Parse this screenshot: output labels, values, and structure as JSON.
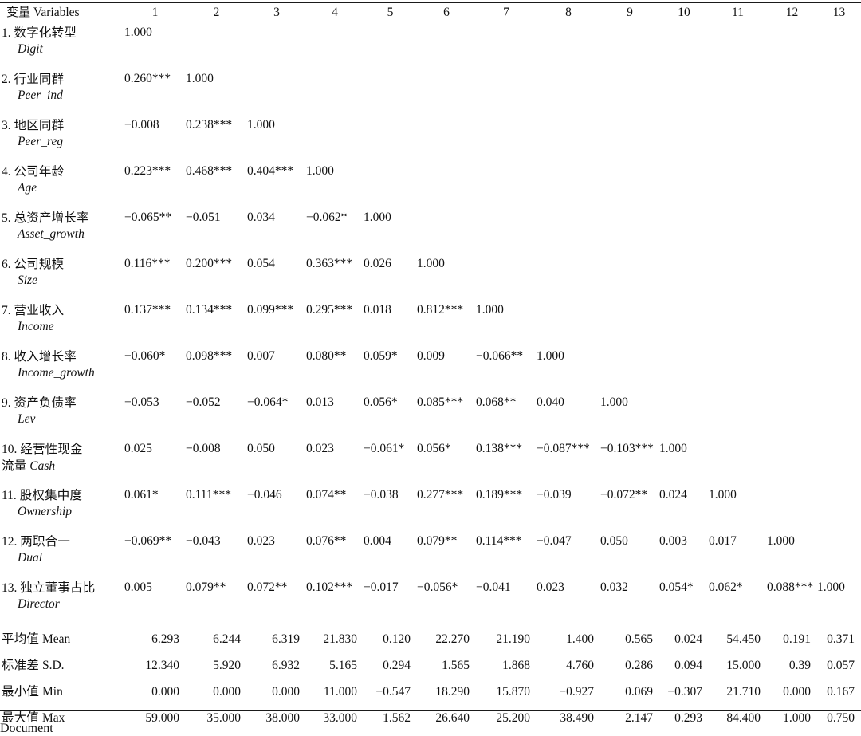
{
  "table": {
    "header": {
      "variables_label_cn": "变量",
      "variables_label_en": "Variables",
      "columns": [
        "1",
        "2",
        "3",
        "4",
        "5",
        "6",
        "7",
        "8",
        "9",
        "10",
        "11",
        "12",
        "13"
      ]
    },
    "rows": [
      {
        "index": "1.",
        "cn": "数字化转型",
        "en": "Digit",
        "two_line_cn": false,
        "values": [
          "1.000",
          "",
          "",
          "",
          "",
          "",
          "",
          "",
          "",
          "",
          "",
          "",
          ""
        ]
      },
      {
        "index": "2.",
        "cn": "行业同群",
        "en": "Peer_ind",
        "two_line_cn": false,
        "values": [
          "0.260***",
          "1.000",
          "",
          "",
          "",
          "",
          "",
          "",
          "",
          "",
          "",
          "",
          ""
        ]
      },
      {
        "index": "3.",
        "cn": "地区同群",
        "en": "Peer_reg",
        "two_line_cn": false,
        "values": [
          "−0.008",
          "0.238***",
          "1.000",
          "",
          "",
          "",
          "",
          "",
          "",
          "",
          "",
          "",
          ""
        ]
      },
      {
        "index": "4.",
        "cn": "公司年龄",
        "en": "Age",
        "two_line_cn": false,
        "values": [
          "0.223***",
          "0.468***",
          "0.404***",
          "1.000",
          "",
          "",
          "",
          "",
          "",
          "",
          "",
          "",
          ""
        ]
      },
      {
        "index": "5.",
        "cn": "总资产增长率",
        "en": "Asset_growth",
        "two_line_cn": false,
        "values": [
          "−0.065**",
          "−0.051",
          "0.034",
          "−0.062*",
          "1.000",
          "",
          "",
          "",
          "",
          "",
          "",
          "",
          ""
        ]
      },
      {
        "index": "6.",
        "cn": "公司规模",
        "en": "Size",
        "two_line_cn": false,
        "values": [
          "0.116***",
          "0.200***",
          "0.054",
          "0.363***",
          "0.026",
          "1.000",
          "",
          "",
          "",
          "",
          "",
          "",
          ""
        ]
      },
      {
        "index": "7.",
        "cn": "营业收入",
        "en": "Income",
        "two_line_cn": false,
        "values": [
          "0.137***",
          "0.134***",
          "0.099***",
          "0.295***",
          "0.018",
          "0.812***",
          "1.000",
          "",
          "",
          "",
          "",
          "",
          ""
        ]
      },
      {
        "index": "8.",
        "cn": "收入增长率",
        "en": "Income_growth",
        "two_line_cn": false,
        "values": [
          "−0.060*",
          "0.098***",
          "0.007",
          "0.080**",
          "0.059*",
          "0.009",
          "−0.066**",
          "1.000",
          "",
          "",
          "",
          "",
          ""
        ]
      },
      {
        "index": "9.",
        "cn": "资产负债率",
        "en": "Lev",
        "two_line_cn": false,
        "values": [
          "−0.053",
          "−0.052",
          "−0.064*",
          "0.013",
          "0.056*",
          "0.085***",
          "0.068**",
          "0.040",
          "1.000",
          "",
          "",
          "",
          ""
        ]
      },
      {
        "index": "10.",
        "cn": "经营性现金",
        "cn2": "流量",
        "en": "Cash",
        "two_line_cn": true,
        "values": [
          "0.025",
          "−0.008",
          "0.050",
          "0.023",
          "−0.061*",
          "0.056*",
          "0.138***",
          "−0.087***",
          "−0.103***",
          "1.000",
          "",
          "",
          ""
        ]
      },
      {
        "index": "11.",
        "cn": "股权集中度",
        "en": "Ownership",
        "two_line_cn": false,
        "values": [
          "0.061*",
          "0.111***",
          "−0.046",
          "0.074**",
          "−0.038",
          "0.277***",
          "0.189***",
          "−0.039",
          "−0.072**",
          "0.024",
          "1.000",
          "",
          ""
        ]
      },
      {
        "index": "12.",
        "cn": "两职合一",
        "en": "Dual",
        "two_line_cn": false,
        "values": [
          "−0.069**",
          "−0.043",
          "0.023",
          "0.076**",
          "0.004",
          "0.079**",
          "0.114***",
          "−0.047",
          "0.050",
          "0.003",
          "0.017",
          "1.000",
          ""
        ]
      },
      {
        "index": "13.",
        "cn": "独立董事占比",
        "en": "Director",
        "two_line_cn": false,
        "values": [
          "0.005",
          "0.079**",
          "0.072**",
          "0.102***",
          "−0.017",
          "−0.056*",
          "−0.041",
          "0.023",
          "0.032",
          "0.054*",
          "0.062*",
          "0.088***",
          "1.000"
        ]
      }
    ],
    "stats": [
      {
        "cn": "平均值",
        "en": "Mean",
        "values": [
          "6.293",
          "6.244",
          "6.319",
          "21.830",
          "0.120",
          "22.270",
          "21.190",
          "1.400",
          "0.565",
          "0.024",
          "54.450",
          "0.191",
          "0.371"
        ]
      },
      {
        "cn": "标准差",
        "en": "S.D.",
        "values": [
          "12.340",
          "5.920",
          "6.932",
          "5.165",
          "0.294",
          "1.565",
          "1.868",
          "4.760",
          "0.286",
          "0.094",
          "15.000",
          "0.39",
          "0.057"
        ]
      },
      {
        "cn": "最小值",
        "en": "Min",
        "values": [
          "0.000",
          "0.000",
          "0.000",
          "11.000",
          "−0.547",
          "18.290",
          "15.870",
          "−0.927",
          "0.069",
          "−0.307",
          "21.710",
          "0.000",
          "0.167"
        ]
      },
      {
        "cn": "最大值",
        "en": "Max",
        "values": [
          "59.000",
          "35.000",
          "38.000",
          "33.000",
          "1.562",
          "26.640",
          "25.200",
          "38.490",
          "2.147",
          "0.293",
          "84.400",
          "1.000",
          "0.750"
        ]
      }
    ]
  },
  "colors": {
    "text": "#111111",
    "rule": "#1a1a1a",
    "background": "#ffffff"
  }
}
